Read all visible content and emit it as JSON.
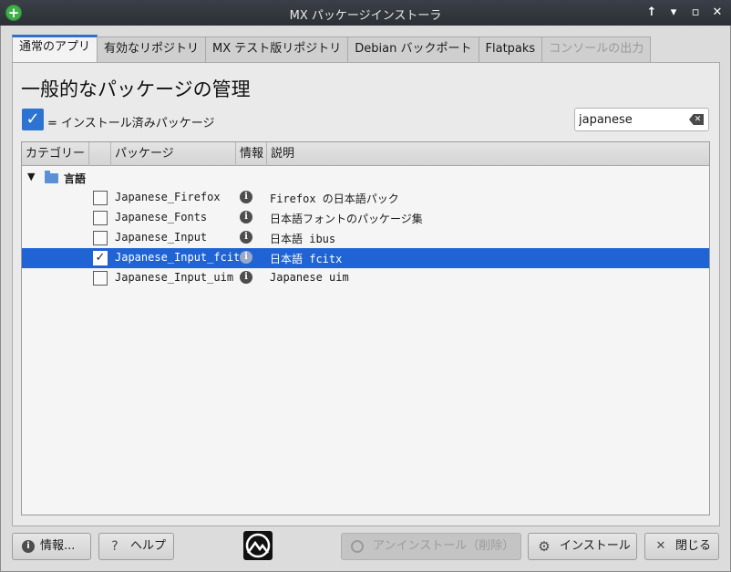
{
  "window": {
    "title": "MX パッケージインストーラ",
    "app_icon": "plus-icon",
    "controls": [
      "↑",
      "▾",
      "▫",
      "✕"
    ]
  },
  "tabs": [
    {
      "label": "通常のアプリ",
      "state": "active"
    },
    {
      "label": "有効なリポジトリ",
      "state": "normal"
    },
    {
      "label": "MX テスト版リポジトリ",
      "state": "normal"
    },
    {
      "label": "Debian バックポート",
      "state": "normal"
    },
    {
      "label": "Flatpaks",
      "state": "normal"
    },
    {
      "label": "コンソールの出力",
      "state": "disabled"
    }
  ],
  "main": {
    "heading": "一般的なパッケージの管理",
    "legend_label": "= インストール済みパッケージ",
    "search_value": "japanese"
  },
  "tree": {
    "columns": [
      "カテゴリー",
      "パッケージ",
      "情報",
      "説明"
    ],
    "category": {
      "label": "言語",
      "expanded": true
    },
    "rows": [
      {
        "package": "Japanese_Firefox",
        "description": "Firefox の日本語パック",
        "installed": false,
        "selected": false
      },
      {
        "package": "Japanese_Fonts",
        "description": "日本語フォントのパッケージ集",
        "installed": false,
        "selected": false
      },
      {
        "package": "Japanese_Input",
        "description": "日本語 ibus",
        "installed": false,
        "selected": false
      },
      {
        "package": "Japanese_Input_fcitx",
        "description": "日本語 fcitx",
        "installed": false,
        "selected": true
      },
      {
        "package": "Japanese_Input_uim",
        "description": "Japanese uim",
        "installed": false,
        "selected": false
      }
    ]
  },
  "buttons": {
    "about": "情報...",
    "help": "ヘルプ",
    "uninstall": "アンインストール（削除）",
    "install": "インストール",
    "close": "閉じる"
  },
  "colors": {
    "accent": "#2f71c9",
    "selection": "#1f63d5",
    "titlebar": "#2c2f35"
  }
}
